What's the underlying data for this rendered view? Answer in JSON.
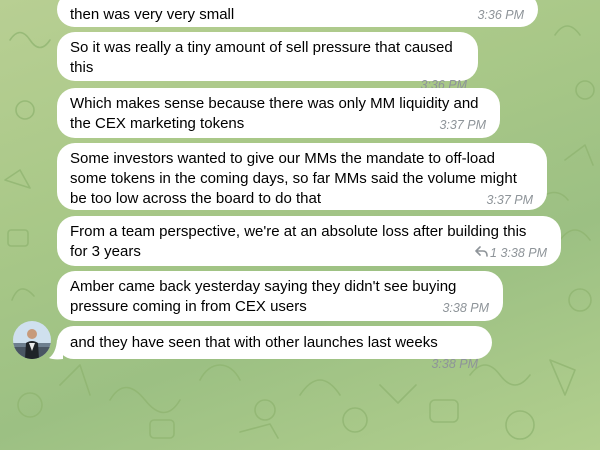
{
  "messages": [
    {
      "text": "then was very very small",
      "time": "3:36 PM"
    },
    {
      "text": "So it was really a tiny amount of sell pressure that caused this",
      "time": "3:36 PM"
    },
    {
      "text": "Which makes sense because there was only MM liquidity and the CEX marketing tokens",
      "time": "3:37 PM"
    },
    {
      "text": "Some investors wanted to give our MMs the mandate to off-load some tokens in the coming days, so far MMs said the volume might be too low across the board to do that",
      "time": "3:37 PM"
    },
    {
      "text": "From a team perspective, we're at an absolute loss after building this for 3 years",
      "reply_count": "1",
      "time": "3:38 PM"
    },
    {
      "text": "Amber came back yesterday saying they didn't see buying pressure coming in from CEX users",
      "time": "3:38 PM"
    },
    {
      "text": "and they have seen that with other launches last weeks",
      "time": "3:38 PM"
    }
  ],
  "icons": {
    "reply": "reply-arrow-icon",
    "avatar": "avatar",
    "background": "doodle-pattern"
  },
  "colors": {
    "bubble": "#ffffff",
    "timestamp": "#8e9499",
    "background": "#a9c888"
  }
}
